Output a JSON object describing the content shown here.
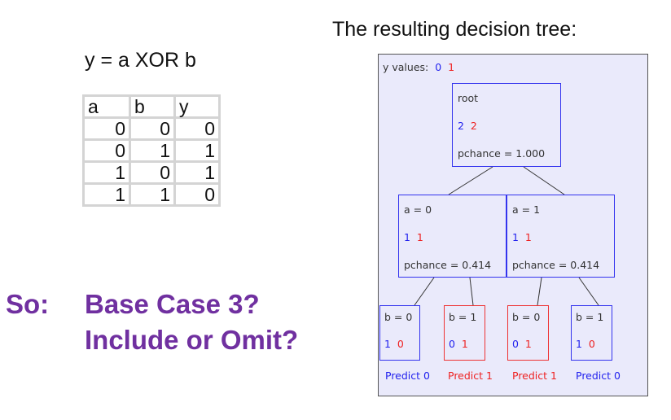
{
  "left": {
    "equation": "y = a XOR b",
    "table": {
      "headers": [
        "a",
        "b",
        "y"
      ],
      "rows": [
        [
          "0",
          "0",
          "0"
        ],
        [
          "0",
          "1",
          "1"
        ],
        [
          "1",
          "0",
          "1"
        ],
        [
          "1",
          "1",
          "0"
        ]
      ]
    },
    "so_label": "So:",
    "question_line1": "Base Case 3?",
    "question_line2": "Include or Omit?"
  },
  "tree": {
    "title": "The resulting decision tree:",
    "y_values_label": "y values:",
    "y_value_0": "0",
    "y_value_1": "1",
    "root": {
      "label": "root",
      "count0": "2",
      "count1": "2",
      "pchance": "pchance = 1.000"
    },
    "a0": {
      "label": "a = 0",
      "count0": "1",
      "count1": "1",
      "pchance": "pchance = 0.414"
    },
    "a1": {
      "label": "a = 1",
      "count0": "1",
      "count1": "1",
      "pchance": "pchance = 0.414"
    },
    "leaves": [
      {
        "label": "b = 0",
        "count0": "1",
        "count1": "0",
        "predict": "Predict 0"
      },
      {
        "label": "b = 1",
        "count0": "0",
        "count1": "1",
        "predict": "Predict 1"
      },
      {
        "label": "b = 0",
        "count0": "0",
        "count1": "1",
        "predict": "Predict 1"
      },
      {
        "label": "b = 1",
        "count0": "1",
        "count1": "0",
        "predict": "Predict 0"
      }
    ]
  },
  "colors": {
    "purple": "#7030a0",
    "blue": "#2222ee",
    "red": "#ee2222",
    "panel": "#eaeafb"
  }
}
